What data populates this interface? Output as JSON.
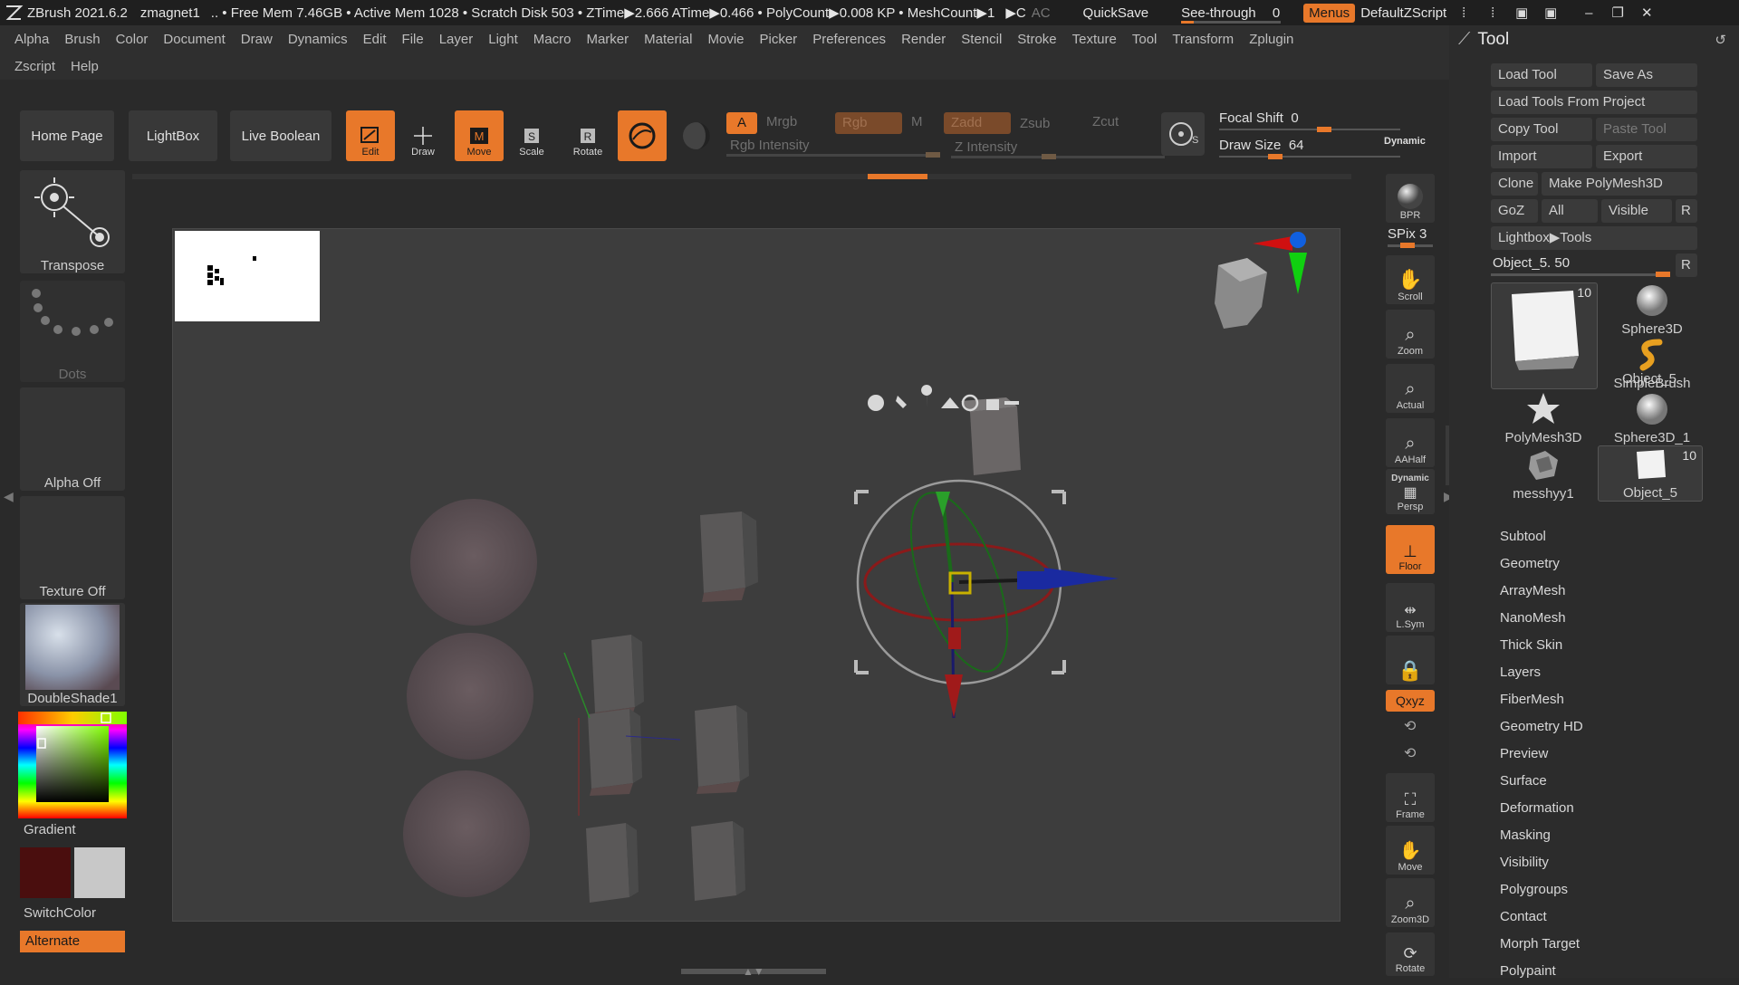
{
  "titlebar": {
    "app": "ZBrush 2021.6.2",
    "doc": "zmagnet1",
    "status": ".. • Free Mem 7.46GB • Active Mem 1028 • Scratch Disk 503 • ZTime▶2.666 ATime▶0.466 • PolyCount▶0.008 KP • MeshCount▶1",
    "play": "▶C",
    "ac": "AC",
    "quicksave": "QuickSave",
    "seethrough": "See-through",
    "seethrough_value": "0",
    "menus": "Menus",
    "defaultzscript": "DefaultZScript"
  },
  "menubar": {
    "row1": [
      "Alpha",
      "Brush",
      "Color",
      "Document",
      "Draw",
      "Dynamics",
      "Edit",
      "File",
      "Layer",
      "Light",
      "Macro",
      "Marker",
      "Material",
      "Movie",
      "Picker",
      "Preferences",
      "Render",
      "Stencil",
      "Stroke",
      "Texture",
      "Tool",
      "Transform",
      "Zplugin"
    ],
    "row2": [
      "Zscript",
      "Help"
    ]
  },
  "topshelf": {
    "home": "Home Page",
    "lightbox": "LightBox",
    "liveboolean": "Live Boolean",
    "edit": "Edit",
    "draw": "Draw",
    "move": "Move",
    "scale": "Scale",
    "rotate": "Rotate",
    "a": "A",
    "mrgb": "Mrgb",
    "rgb": "Rgb",
    "m": "M",
    "zadd": "Zadd",
    "zsub": "Zsub",
    "zcut": "Zcut",
    "rgb_intensity": "Rgb Intensity",
    "z_intensity": "Z Intensity",
    "focal_shift_label": "Focal Shift",
    "focal_shift_value": "0",
    "draw_size_label": "Draw Size",
    "draw_size_value": "64",
    "dynamic": "Dynamic"
  },
  "leftshelf": {
    "transpose": "Transpose",
    "dots": "Dots",
    "alpha": "Alpha Off",
    "texture": "Texture Off",
    "material": "DoubleShade1",
    "gradient": "Gradient",
    "switchcolor": "SwitchColor",
    "alternate": "Alternate"
  },
  "rightshelf": {
    "bpr": "BPR",
    "spix": "SPix 3",
    "scroll": "Scroll",
    "zoom": "Zoom",
    "actual": "Actual",
    "aahalf": "AAHalf",
    "dynamic": "Dynamic",
    "persp": "Persp",
    "floor": "Floor",
    "lsym": "L.Sym",
    "xyz": "Qxyz",
    "frame": "Frame",
    "move": "Move",
    "zoom3d": "Zoom3D",
    "rotate": "Rotate"
  },
  "toolpanel": {
    "title": "Tool",
    "load_tool": "Load Tool",
    "save_as": "Save As",
    "load_from_project": "Load Tools From Project",
    "copy_tool": "Copy Tool",
    "paste_tool": "Paste Tool",
    "import": "Import",
    "export": "Export",
    "clone": "Clone",
    "make_polymesh": "Make PolyMesh3D",
    "goz": "GoZ",
    "all": "All",
    "visible": "Visible",
    "r": "R",
    "lightbox_tools": "Lightbox▶Tools",
    "object_slider": "Object_5. 50",
    "thumbs": [
      {
        "label": "Object_5",
        "badge": "10"
      },
      {
        "label": "Sphere3D"
      },
      {
        "label": "SimpleBrush"
      },
      {
        "label": "PolyMesh3D"
      },
      {
        "label": "Sphere3D_1"
      },
      {
        "label": "messhyy1"
      },
      {
        "label": "Object_5",
        "badge": "10"
      }
    ],
    "subpalettes": [
      "Subtool",
      "Geometry",
      "ArrayMesh",
      "NanoMesh",
      "Thick Skin",
      "Layers",
      "FiberMesh",
      "Geometry HD",
      "Preview",
      "Surface",
      "Deformation",
      "Masking",
      "Visibility",
      "Polygroups",
      "Contact",
      "Morph Target",
      "Polypaint"
    ]
  },
  "colors": {
    "accent": "#e8782a",
    "background": "#2a2a2a",
    "canvas": "#3d3d3d"
  }
}
